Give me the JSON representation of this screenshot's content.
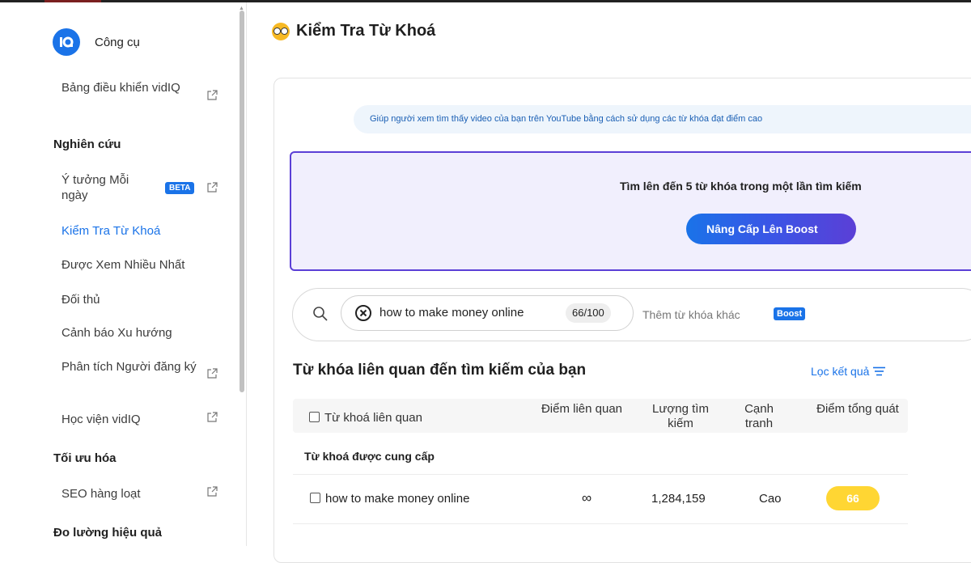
{
  "sidebar": {
    "tool_label": "Công cụ",
    "items": [
      {
        "label": "Bảng điều khiển vidIQ"
      },
      {
        "section": "Nghiên cứu"
      },
      {
        "label": "Ý tưởng Mỗi ngày",
        "badge": "BETA"
      },
      {
        "label": "Kiểm Tra Từ Khoá",
        "active": true
      },
      {
        "label": "Được Xem Nhiều Nhất"
      },
      {
        "label": "Đối thủ"
      },
      {
        "label": "Cảnh báo Xu hướng"
      },
      {
        "label": "Phân tích Người đăng ký"
      },
      {
        "label": "Học viện vidIQ"
      },
      {
        "section": "Tối ưu hóa"
      },
      {
        "label": "SEO hàng loạt"
      },
      {
        "section": "Đo lường hiệu quả"
      }
    ]
  },
  "main": {
    "title": "Kiểm Tra Từ Khoá",
    "help_text": "Giúp người xem tìm thấy video của bạn trên YouTube bằng cách sử dụng các từ khóa đạt điểm cao",
    "promo": {
      "text": "Tìm lên đến 5 từ khóa trong một lần tìm kiếm",
      "button": "Nâng Cấp Lên Boost"
    },
    "search": {
      "chip_text": "how to make money online",
      "chip_score": "66/100",
      "add_placeholder": "Thêm từ khóa khác",
      "add_badge": "Boost"
    },
    "results": {
      "title": "Từ khóa liên quan đến tìm kiếm của bạn",
      "filter_label": "Lọc kết quả",
      "columns": {
        "keyword": "Từ khoá liên quan",
        "relevance": "Điểm liên quan",
        "volume": "Lượng tìm kiếm",
        "competition": "Cạnh tranh",
        "overall": "Điểm tổng quát"
      },
      "group_label": "Từ khoá được cung cấp",
      "rows": [
        {
          "keyword": "how to make money online",
          "relevance": "∞",
          "volume": "1,284,159",
          "competition": "Cao",
          "overall": "66"
        }
      ]
    }
  },
  "colors": {
    "accent": "#1a73e8",
    "promo_border": "#5b3fd6",
    "score_badge": "#ffd633"
  }
}
